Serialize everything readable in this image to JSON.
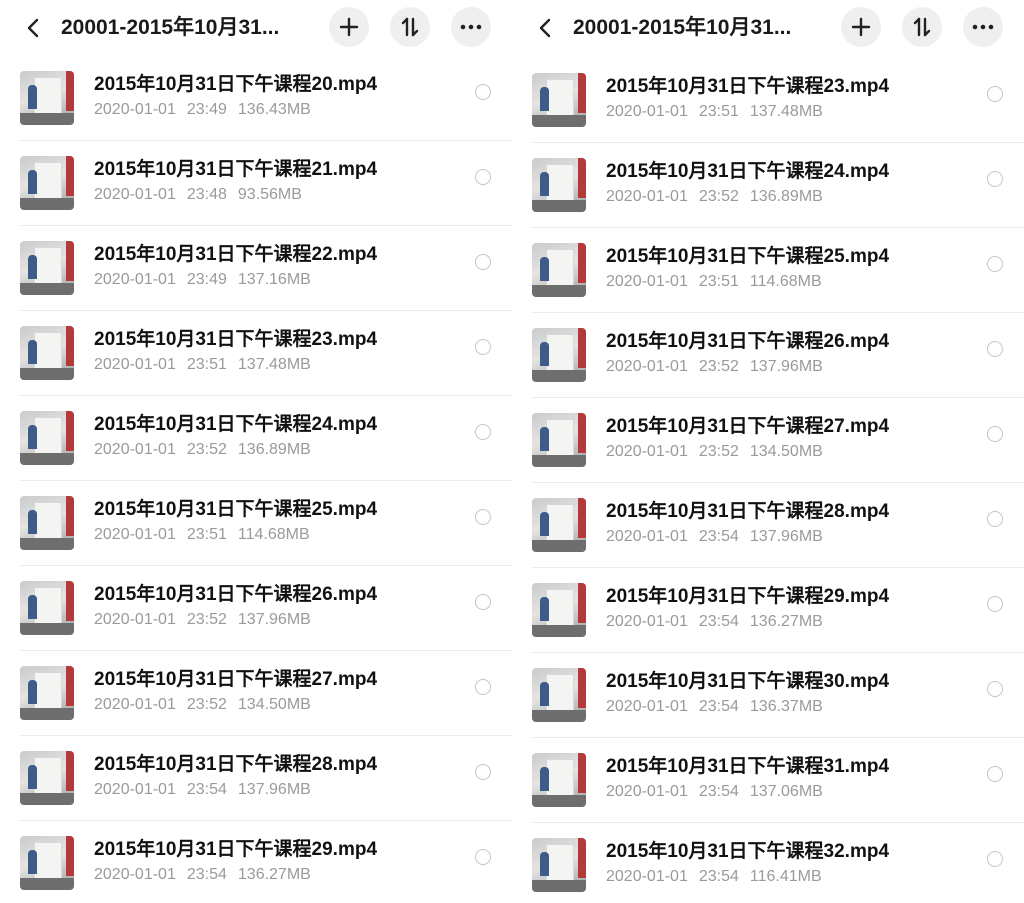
{
  "panes": [
    {
      "header": {
        "title": "20001-2015年10月31..."
      },
      "items": [
        {
          "name": "2015年10月31日下午课程20.mp4",
          "date": "2020-01-01",
          "time": "23:49",
          "size": "136.43MB"
        },
        {
          "name": "2015年10月31日下午课程21.mp4",
          "date": "2020-01-01",
          "time": "23:48",
          "size": "93.56MB"
        },
        {
          "name": "2015年10月31日下午课程22.mp4",
          "date": "2020-01-01",
          "time": "23:49",
          "size": "137.16MB"
        },
        {
          "name": "2015年10月31日下午课程23.mp4",
          "date": "2020-01-01",
          "time": "23:51",
          "size": "137.48MB"
        },
        {
          "name": "2015年10月31日下午课程24.mp4",
          "date": "2020-01-01",
          "time": "23:52",
          "size": "136.89MB"
        },
        {
          "name": "2015年10月31日下午课程25.mp4",
          "date": "2020-01-01",
          "time": "23:51",
          "size": "114.68MB"
        },
        {
          "name": "2015年10月31日下午课程26.mp4",
          "date": "2020-01-01",
          "time": "23:52",
          "size": "137.96MB"
        },
        {
          "name": "2015年10月31日下午课程27.mp4",
          "date": "2020-01-01",
          "time": "23:52",
          "size": "134.50MB"
        },
        {
          "name": "2015年10月31日下午课程28.mp4",
          "date": "2020-01-01",
          "time": "23:54",
          "size": "137.96MB"
        },
        {
          "name": "2015年10月31日下午课程29.mp4",
          "date": "2020-01-01",
          "time": "23:54",
          "size": "136.27MB"
        }
      ]
    },
    {
      "header": {
        "title": "20001-2015年10月31..."
      },
      "items": [
        {
          "name": "2015年10月31日下午课程23.mp4",
          "date": "2020-01-01",
          "time": "23:51",
          "size": "137.48MB"
        },
        {
          "name": "2015年10月31日下午课程24.mp4",
          "date": "2020-01-01",
          "time": "23:52",
          "size": "136.89MB"
        },
        {
          "name": "2015年10月31日下午课程25.mp4",
          "date": "2020-01-01",
          "time": "23:51",
          "size": "114.68MB"
        },
        {
          "name": "2015年10月31日下午课程26.mp4",
          "date": "2020-01-01",
          "time": "23:52",
          "size": "137.96MB"
        },
        {
          "name": "2015年10月31日下午课程27.mp4",
          "date": "2020-01-01",
          "time": "23:52",
          "size": "134.50MB"
        },
        {
          "name": "2015年10月31日下午课程28.mp4",
          "date": "2020-01-01",
          "time": "23:54",
          "size": "137.96MB"
        },
        {
          "name": "2015年10月31日下午课程29.mp4",
          "date": "2020-01-01",
          "time": "23:54",
          "size": "136.27MB"
        },
        {
          "name": "2015年10月31日下午课程30.mp4",
          "date": "2020-01-01",
          "time": "23:54",
          "size": "136.37MB"
        },
        {
          "name": "2015年10月31日下午课程31.mp4",
          "date": "2020-01-01",
          "time": "23:54",
          "size": "137.06MB"
        },
        {
          "name": "2015年10月31日下午课程32.mp4",
          "date": "2020-01-01",
          "time": "23:54",
          "size": "116.41MB"
        }
      ]
    }
  ],
  "icons": {
    "back": "chevron-left-icon",
    "add": "plus-icon",
    "sort": "sort-icon",
    "more": "more-horizontal-icon",
    "select": "radio-circle-icon",
    "thumbnail": "video-thumbnail"
  }
}
